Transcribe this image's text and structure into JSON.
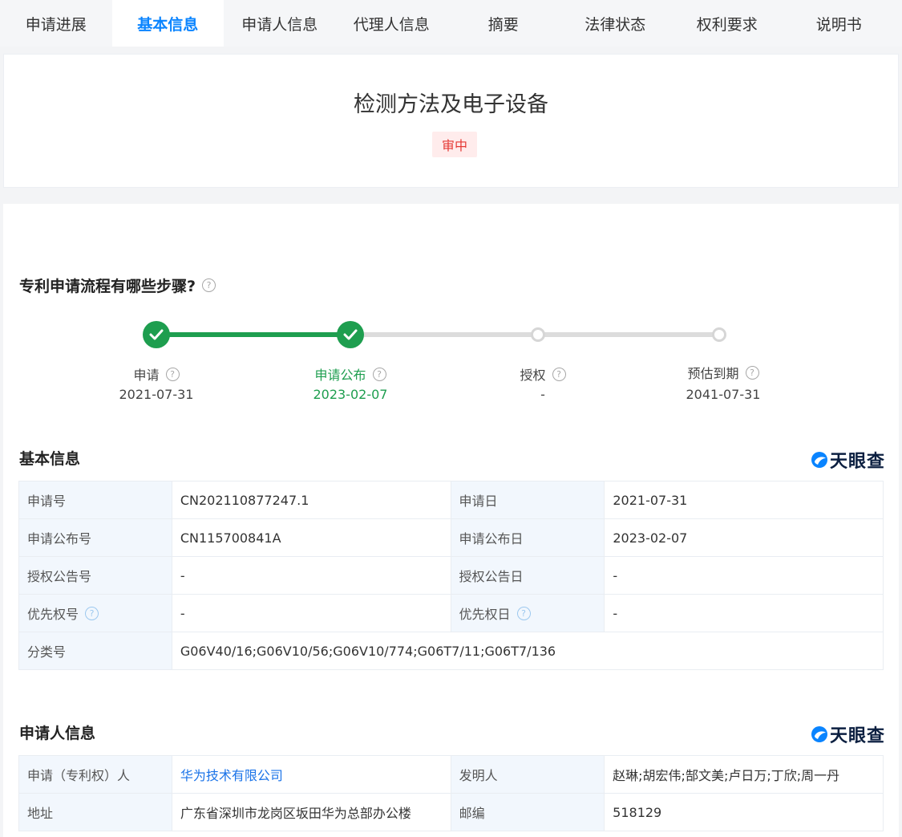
{
  "tabs": [
    {
      "label": "申请进展",
      "active": false
    },
    {
      "label": "基本信息",
      "active": true
    },
    {
      "label": "申请人信息",
      "active": false
    },
    {
      "label": "代理人信息",
      "active": false
    },
    {
      "label": "摘要",
      "active": false
    },
    {
      "label": "法律状态",
      "active": false
    },
    {
      "label": "权利要求",
      "active": false
    },
    {
      "label": "说明书",
      "active": false
    }
  ],
  "header": {
    "title": "检测方法及电子设备",
    "status_badge": "审中"
  },
  "process": {
    "heading": "专利申请流程有哪些步骤?",
    "steps": [
      {
        "label": "申请",
        "date": "2021-07-31",
        "done": true
      },
      {
        "label": "申请公布",
        "date": "2023-02-07",
        "done": true
      },
      {
        "label": "授权",
        "date": "-",
        "done": false
      },
      {
        "label": "预估到期",
        "date": "2041-07-31",
        "done": false
      }
    ]
  },
  "brand": {
    "name": "天眼查"
  },
  "basic_info": {
    "heading": "基本信息",
    "rows": [
      {
        "k1": "申请号",
        "v1": "CN202110877247.1",
        "k2": "申请日",
        "v2": "2021-07-31"
      },
      {
        "k1": "申请公布号",
        "v1": "CN115700841A",
        "k2": "申请公布日",
        "v2": "2023-02-07"
      },
      {
        "k1": "授权公告号",
        "v1": "-",
        "k2": "授权公告日",
        "v2": "-"
      },
      {
        "k1": "优先权号",
        "v1": "-",
        "k2": "优先权日",
        "v2": "-"
      }
    ],
    "classification": {
      "k": "分类号",
      "v": "G06V40/16;G06V10/56;G06V10/774;G06T7/11;G06T7/136"
    }
  },
  "applicant_info": {
    "heading": "申请人信息",
    "rows": [
      {
        "k1": "申请（专利权）人",
        "v1": "华为技术有限公司",
        "k2": "发明人",
        "v2": "赵琳;胡宏伟;郜文美;卢日万;丁欣;周一丹"
      },
      {
        "k1": "地址",
        "v1": "广东省深圳市龙岗区坂田华为总部办公楼",
        "k2": "邮编",
        "v2": "518129"
      }
    ]
  },
  "colors": {
    "accent": "#0a84ff",
    "done": "#1e9e4f",
    "pending": "#d6d6d6",
    "badge_bg": "#ffecec",
    "badge_text": "#e53935",
    "key_cell_bg": "#f2f7fd"
  }
}
